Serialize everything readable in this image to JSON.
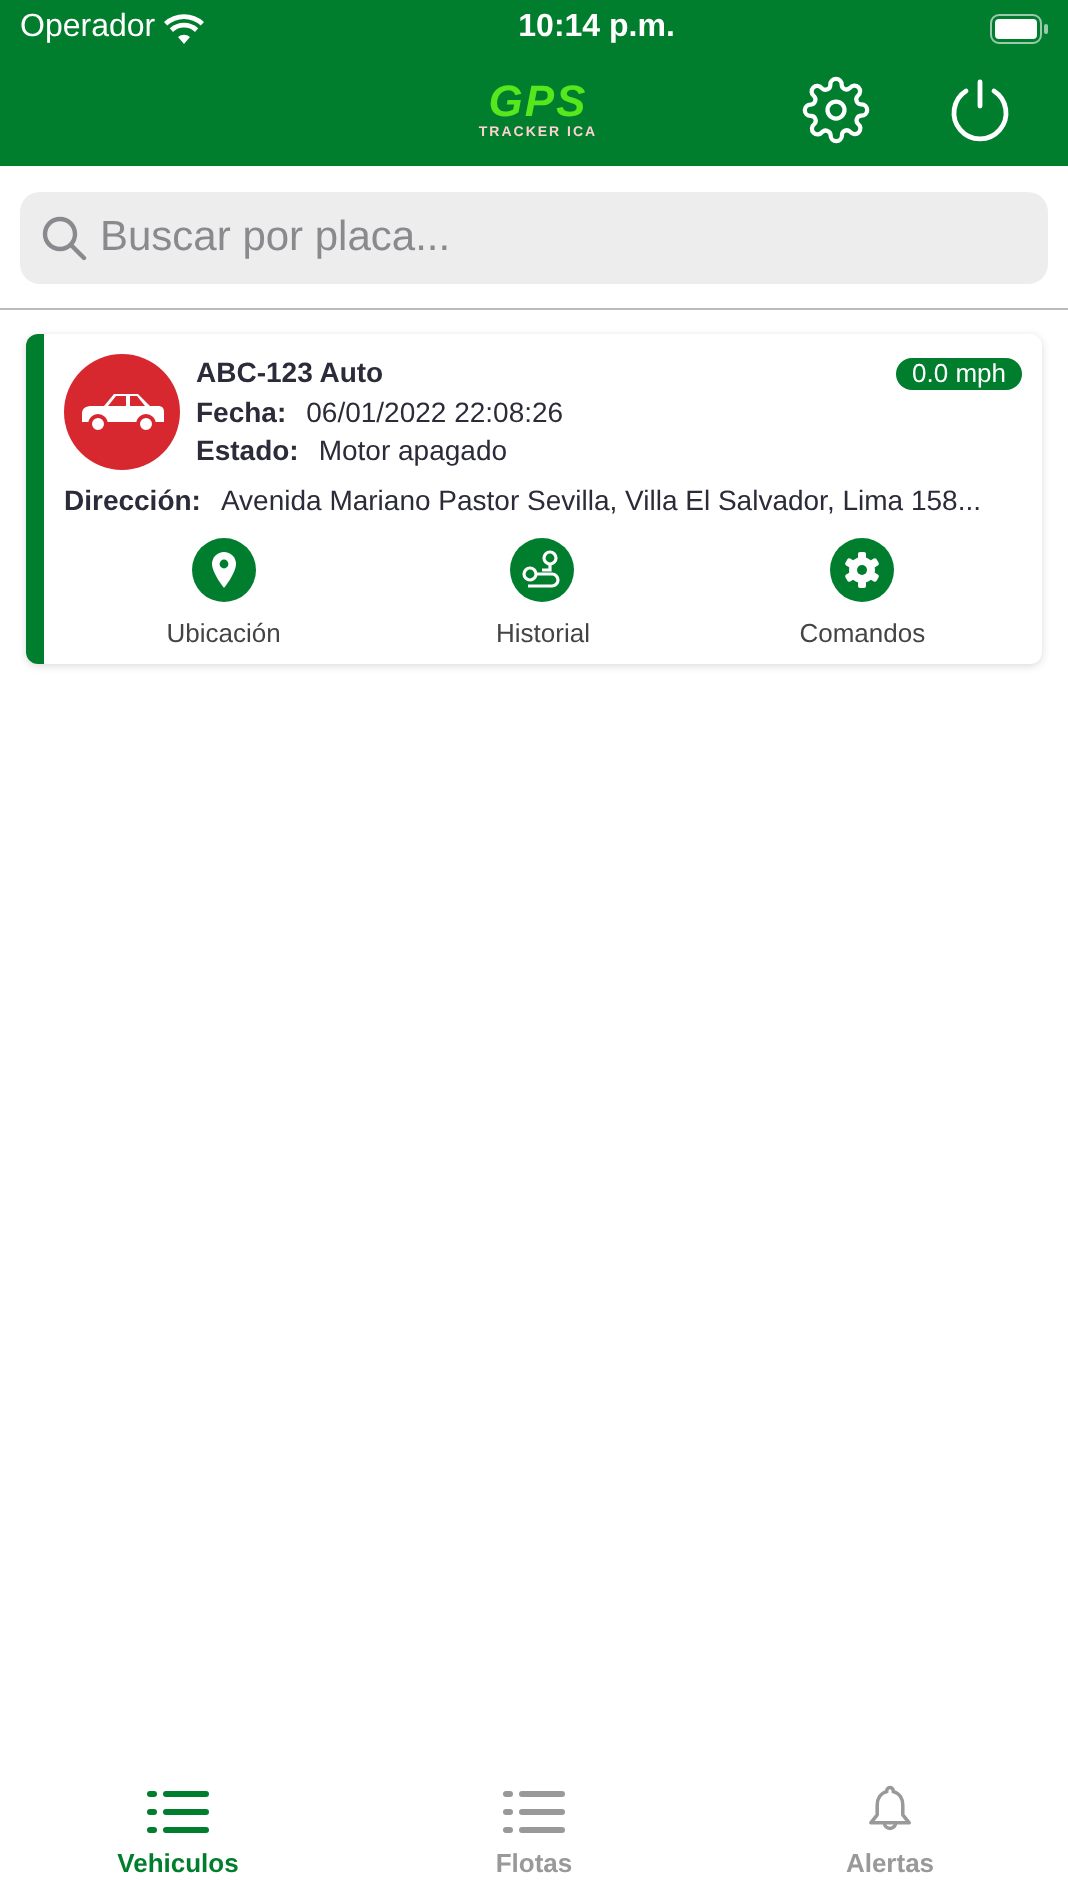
{
  "status_bar": {
    "carrier": "Operador",
    "time": "10:14 p.m."
  },
  "header": {
    "logo": {
      "title": "GPS",
      "subtitle": "TRACKER ICA"
    }
  },
  "search": {
    "placeholder": "Buscar por placa..."
  },
  "vehicles": [
    {
      "name": "ABC-123 Auto",
      "speed": "0.0 mph",
      "fields": [
        {
          "label": "Fecha:",
          "value": "06/01/2022 22:08:26"
        },
        {
          "label": "Estado:",
          "value": "Motor apagado"
        }
      ],
      "address_label": "Dirección:",
      "address": "Avenida Mariano Pastor Sevilla, Villa El Salvador, Lima 158...",
      "actions": [
        {
          "kind": "pin",
          "label": "Ubicación"
        },
        {
          "kind": "route",
          "label": "Historial"
        },
        {
          "kind": "gear",
          "label": "Comandos"
        }
      ]
    }
  ],
  "tabs": [
    {
      "kind": "list",
      "label": "Vehiculos",
      "selected": true
    },
    {
      "kind": "list",
      "label": "Flotas",
      "selected": false
    },
    {
      "kind": "bell",
      "label": "Alertas",
      "selected": false
    }
  ]
}
